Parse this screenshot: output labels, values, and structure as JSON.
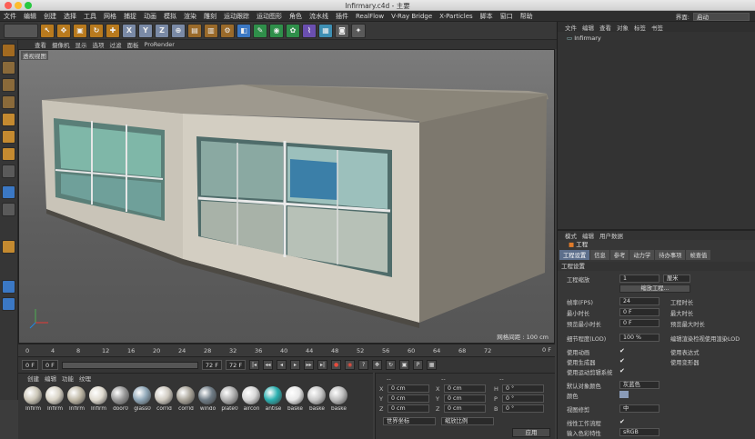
{
  "window": {
    "title": "Infirmary.c4d - 主要"
  },
  "menubar": [
    "文件",
    "编辑",
    "创建",
    "选择",
    "工具",
    "网格",
    "捕捉",
    "动画",
    "模拟",
    "渲染",
    "雕刻",
    "运动跟踪",
    "运动图形",
    "角色",
    "流水线",
    "插件",
    "RealFlow",
    "V-Ray Bridge",
    "X-Particles",
    "脚本",
    "窗口",
    "帮助"
  ],
  "interface": {
    "label": "界面:",
    "value": "启动"
  },
  "toolbar": {
    "xyz": [
      "X",
      "Y",
      "Z"
    ]
  },
  "view_menu": [
    "查看",
    "摄像机",
    "显示",
    "选项",
    "过滤",
    "面板",
    "ProRender"
  ],
  "viewport": {
    "label": "透视视图",
    "grid_spacing": "网格间距 : 100 cm"
  },
  "timeline": {
    "ticks": [
      "0",
      "4",
      "8",
      "12",
      "16",
      "20",
      "24",
      "28",
      "32",
      "36",
      "40",
      "44",
      "48",
      "52",
      "56",
      "60",
      "64",
      "68",
      "72"
    ],
    "end_frame": "0 F"
  },
  "transport": {
    "start": "0 F",
    "min": "0 F",
    "max": "72 F",
    "end": "72 F"
  },
  "materials": {
    "menu": [
      "创建",
      "编辑",
      "功能",
      "纹理"
    ],
    "items": [
      "Infirm",
      "Infirm",
      "Infirm",
      "Infirm",
      "door0",
      "glass0",
      "corrid",
      "corrid",
      "windo",
      "plate0",
      "aircon",
      "antise",
      "baske",
      "baske",
      "baske"
    ]
  },
  "coords": {
    "sections": [
      "--",
      "--",
      "--"
    ],
    "rows": [
      {
        "a": "X",
        "av": "0 cm",
        "b": "X",
        "bv": "0 cm",
        "c": "H",
        "cv": "0 °"
      },
      {
        "a": "Y",
        "av": "0 cm",
        "b": "Y",
        "bv": "0 cm",
        "c": "P",
        "cv": "0 °"
      },
      {
        "a": "Z",
        "av": "0 cm",
        "b": "Z",
        "bv": "0 cm",
        "c": "B",
        "cv": "0 °"
      }
    ],
    "world": "世界坐标",
    "scale": "缩放比例",
    "apply": "应用"
  },
  "object_manager": {
    "menu": [
      "文件",
      "编辑",
      "查看",
      "对象",
      "标签",
      "书签"
    ],
    "object": "Infirmary"
  },
  "attributes": {
    "menu": [
      "模式",
      "编辑",
      "用户数据"
    ],
    "title": "工程",
    "tabs": [
      "工程设置",
      "信息",
      "参考",
      "动力学",
      "待办事项",
      "帧查值"
    ],
    "section": "工程设置",
    "scale_label": "工程缩放",
    "scale_value": "1",
    "scale_unit": "厘米",
    "scale_button": "缩放工程...",
    "fps_label": "帧率(FPS)",
    "fps_value": "24",
    "min_label": "最小时长",
    "min_value": "0 F",
    "preview_min_label": "预览最小时长",
    "preview_min_value": "0 F",
    "project_time": "工程时长",
    "max_time": "最大时长",
    "preview_max": "预览最大时长",
    "lod_label": "细节程度(LOD)",
    "lod_value": "100 %",
    "lod_right": "编辑渲染检视使用渲染LOD",
    "use_anim": "使用动画",
    "use_expr": "使用表达式",
    "use_gen": "使用生成器",
    "use_deform": "使用变形器",
    "use_motion": "使用运动剪辑系统",
    "default_color_label": "默认对象颜色",
    "default_color_value": "灰蓝色",
    "color_label": "颜色",
    "view_label": "视图修剪",
    "view_value": "中",
    "linear_label": "线性工作流程",
    "input_label": "输入色彩特性",
    "input_value": "sRGB"
  }
}
